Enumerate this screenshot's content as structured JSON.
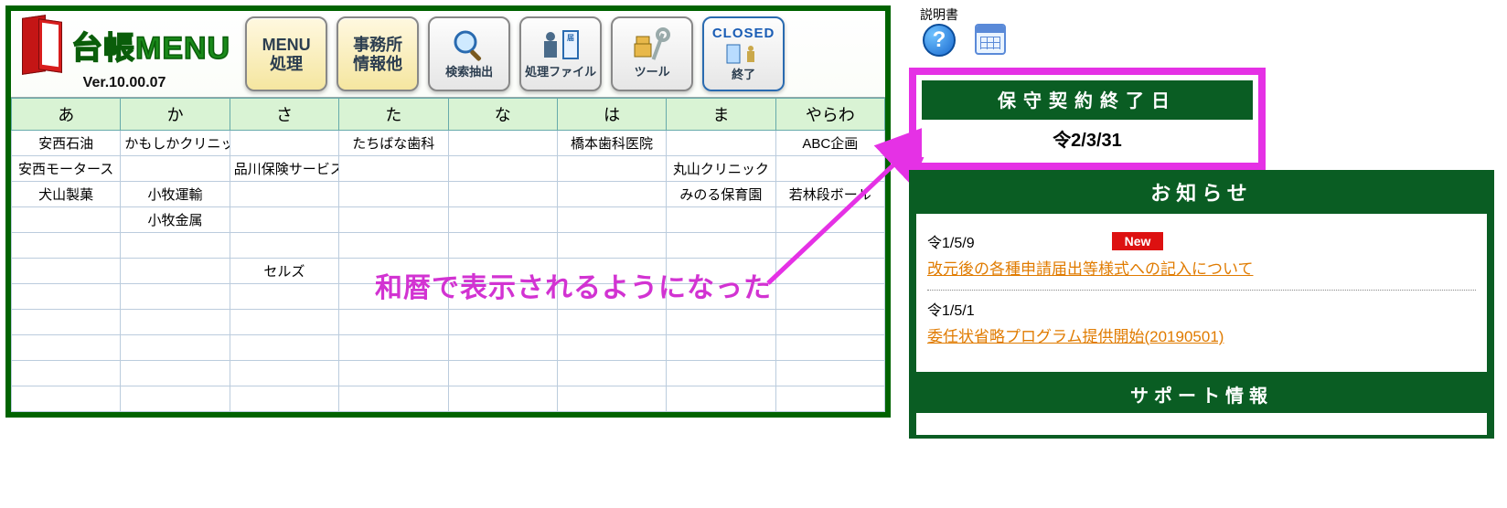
{
  "app": {
    "title": "台帳MENU",
    "version": "Ver.10.00.07"
  },
  "toolbar": [
    {
      "id": "menu-process",
      "label": "MENU\n処理"
    },
    {
      "id": "office-info",
      "label": "事務所\n情報他"
    },
    {
      "id": "search",
      "label": "検索抽出"
    },
    {
      "id": "process-file",
      "label": "処理ファイル"
    },
    {
      "id": "tools",
      "label": "ツール"
    },
    {
      "id": "close",
      "label": "終了",
      "extra": "CLOSED"
    }
  ],
  "index_headers": [
    "あ",
    "か",
    "さ",
    "た",
    "な",
    "は",
    "ま",
    "やらわ"
  ],
  "index_grid": [
    [
      "安西石油",
      "かもしかクリニック",
      "",
      "たちばな歯科",
      "",
      "橋本歯科医院",
      "",
      "ABC企画"
    ],
    [
      "安西モータース",
      "",
      "品川保険サービス",
      "",
      "",
      "",
      "丸山クリニック",
      ""
    ],
    [
      "犬山製菓",
      "小牧運輸",
      "",
      "",
      "",
      "",
      "みのる保育園",
      "若林段ボール"
    ],
    [
      "",
      "小牧金属",
      "",
      "",
      "",
      "",
      "",
      ""
    ],
    [
      "",
      "",
      "",
      "",
      "",
      "",
      "",
      ""
    ],
    [
      "",
      "",
      "セルズ",
      "",
      "",
      "",
      "",
      ""
    ],
    [
      "",
      "",
      "",
      "",
      "",
      "",
      "",
      ""
    ],
    [
      "",
      "",
      "",
      "",
      "",
      "",
      "",
      ""
    ],
    [
      "",
      "",
      "",
      "",
      "",
      "",
      "",
      ""
    ],
    [
      "",
      "",
      "",
      "",
      "",
      "",
      "",
      ""
    ],
    [
      "",
      "",
      "",
      "",
      "",
      "",
      "",
      ""
    ]
  ],
  "annotation": "和暦で表示されるようになった",
  "right_top": {
    "manual_label": "説明書"
  },
  "contract": {
    "title": "保守契約終了日",
    "date": "令2/3/31"
  },
  "news": {
    "title": "お知らせ",
    "items": [
      {
        "date": "令1/5/9",
        "new": true,
        "text": "改元後の各種申請届出等様式への記入について"
      },
      {
        "date": "令1/5/1",
        "new": false,
        "text": "委任状省略プログラム提供開始(20190501)"
      }
    ]
  },
  "support": {
    "title": "サポート情報"
  }
}
